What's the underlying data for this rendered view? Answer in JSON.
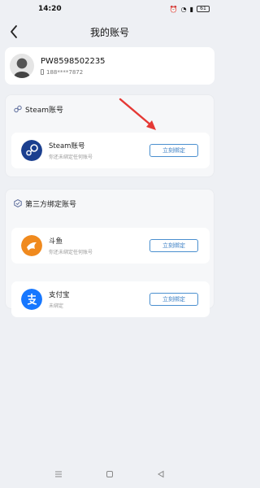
{
  "status_bar": {
    "time": "14:20",
    "battery": "61"
  },
  "header": {
    "title": "我的账号"
  },
  "profile": {
    "username": "PW8598502235",
    "phone": "188****7872"
  },
  "steam_section": {
    "title": "Steam账号",
    "item": {
      "name": "Steam账号",
      "status": "你还未绑定任何账号",
      "button": "立刻绑定"
    }
  },
  "third_party_section": {
    "title": "第三方绑定账号",
    "items": [
      {
        "name": "斗鱼",
        "status": "你还未绑定任何账号",
        "button": "立刻绑定"
      },
      {
        "name": "支付宝",
        "status": "未绑定",
        "button": "立刻绑定"
      }
    ]
  },
  "colors": {
    "accent": "#3b7fc4",
    "douyu": "#f08a1e",
    "alipay": "#1677ff",
    "steam": "#1b3f8f",
    "arrow": "#e53935"
  },
  "icons": [
    "back-arrow-icon",
    "phone-icon",
    "link-icon",
    "steam-logo-icon",
    "shield-icon",
    "douyu-logo-icon",
    "alipay-logo-icon",
    "menu-icon",
    "home-icon",
    "back-icon"
  ]
}
